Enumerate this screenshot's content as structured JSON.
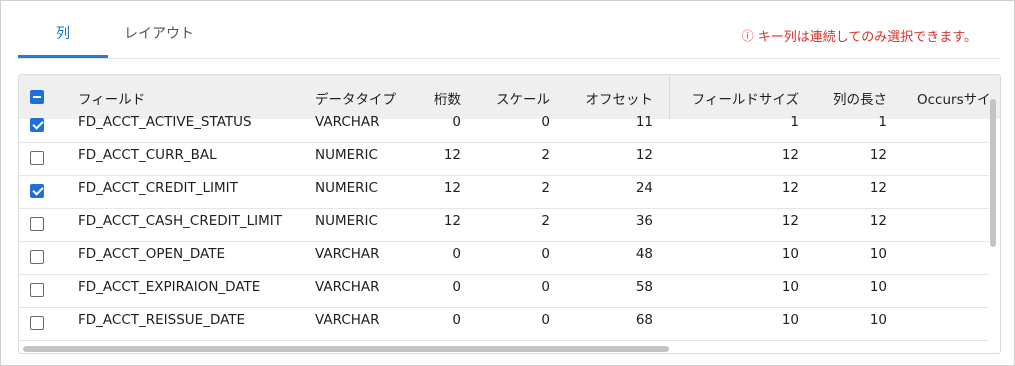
{
  "tabs": [
    {
      "label": "列",
      "active": true
    },
    {
      "label": "レイアウト",
      "active": false
    }
  ],
  "notice": {
    "icon": "info-circle-icon",
    "text": "キー列は連続してのみ選択できます。",
    "color": "#d9312b"
  },
  "grid": {
    "header_checkbox": "indeterminate",
    "columns": [
      "フィールド",
      "データタイプ",
      "桁数",
      "スケール",
      "オフセット",
      "フィールドサイズ",
      "列の長さ",
      "Occursサイ"
    ],
    "rows": [
      {
        "checked": true,
        "field": "FD_ACCT_ACTIVE_STATUS",
        "type": "VARCHAR",
        "digits": "0",
        "scale": "0",
        "offset": "11",
        "field_size": "1",
        "col_len": "1"
      },
      {
        "checked": false,
        "field": "FD_ACCT_CURR_BAL",
        "type": "NUMERIC",
        "digits": "12",
        "scale": "2",
        "offset": "12",
        "field_size": "12",
        "col_len": "12"
      },
      {
        "checked": true,
        "field": "FD_ACCT_CREDIT_LIMIT",
        "type": "NUMERIC",
        "digits": "12",
        "scale": "2",
        "offset": "24",
        "field_size": "12",
        "col_len": "12"
      },
      {
        "checked": false,
        "field": "FD_ACCT_CASH_CREDIT_LIMIT",
        "type": "NUMERIC",
        "digits": "12",
        "scale": "2",
        "offset": "36",
        "field_size": "12",
        "col_len": "12"
      },
      {
        "checked": false,
        "field": "FD_ACCT_OPEN_DATE",
        "type": "VARCHAR",
        "digits": "0",
        "scale": "0",
        "offset": "48",
        "field_size": "10",
        "col_len": "10"
      },
      {
        "checked": false,
        "field": "FD_ACCT_EXPIRAION_DATE",
        "type": "VARCHAR",
        "digits": "0",
        "scale": "0",
        "offset": "58",
        "field_size": "10",
        "col_len": "10"
      },
      {
        "checked": false,
        "field": "FD_ACCT_REISSUE_DATE",
        "type": "VARCHAR",
        "digits": "0",
        "scale": "0",
        "offset": "68",
        "field_size": "10",
        "col_len": "10"
      }
    ]
  },
  "colors": {
    "accent": "#1f6fd6",
    "tab_active": "#1a73c8",
    "header_bg": "#efefef"
  }
}
